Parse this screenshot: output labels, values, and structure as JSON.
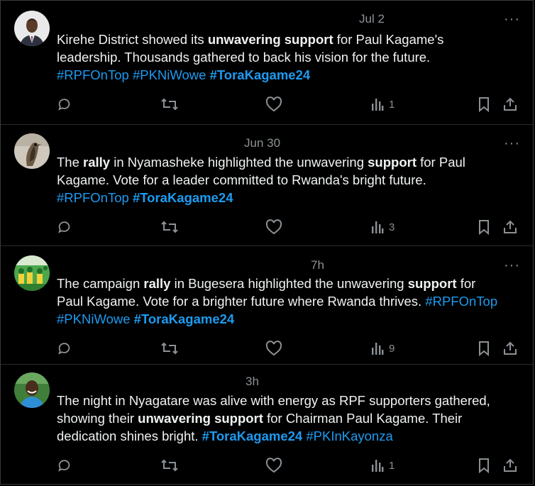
{
  "tweets": [
    {
      "time": "Jul 2",
      "lines": [
        [
          {
            "t": "Kirehe District showed its "
          },
          {
            "t": "unwavering support",
            "b": true
          },
          {
            "t": " for Paul Kagame's"
          }
        ],
        [
          {
            "t": "leadership. Thousands gathered to back his vision for the future."
          }
        ],
        [
          {
            "t": "#RPFOnTop",
            "h": true
          },
          {
            "t": " "
          },
          {
            "t": "#PKNiWowe",
            "h": true
          },
          {
            "t": " "
          },
          {
            "t": "#ToraKagame24",
            "h": true,
            "b": true
          }
        ]
      ],
      "views": "1"
    },
    {
      "time": "Jun 30",
      "lines": [
        [
          {
            "t": "The "
          },
          {
            "t": "rally",
            "b": true
          },
          {
            "t": " in Nyamasheke highlighted the unwavering "
          },
          {
            "t": "support",
            "b": true
          },
          {
            "t": " for Paul"
          }
        ],
        [
          {
            "t": "Kagame. Vote for a leader committed to Rwanda's bright future."
          }
        ],
        [
          {
            "t": "#RPFOnTop",
            "h": true
          },
          {
            "t": "  "
          },
          {
            "t": "#ToraKagame24",
            "h": true,
            "b": true
          }
        ]
      ],
      "views": "3"
    },
    {
      "time": "7h",
      "lines": [
        [
          {
            "t": "The campaign "
          },
          {
            "t": "rally",
            "b": true
          },
          {
            "t": " in Bugesera highlighted the unwavering "
          },
          {
            "t": "support",
            "b": true
          },
          {
            "t": " for"
          }
        ],
        [
          {
            "t": "Paul Kagame. Vote for a brighter future where Rwanda thrives. "
          },
          {
            "t": "#RPFOnTop",
            "h": true
          }
        ],
        [
          {
            "t": "#PKNiWowe",
            "h": true
          },
          {
            "t": " "
          },
          {
            "t": "#ToraKagame24",
            "h": true,
            "b": true
          }
        ]
      ],
      "views": "9"
    },
    {
      "time": "3h",
      "lines": [
        [
          {
            "t": "The night in Nyagatare was alive with energy as RPF supporters gathered,"
          }
        ],
        [
          {
            "t": "showing their "
          },
          {
            "t": "unwavering support",
            "b": true
          },
          {
            "t": " for Chairman Paul Kagame. Their"
          }
        ],
        [
          {
            "t": "dedication shines bright. "
          },
          {
            "t": "#ToraKagame24",
            "h": true,
            "b": true
          },
          {
            "t": " "
          },
          {
            "t": "#PKInKayonza",
            "h": true
          }
        ]
      ],
      "views": "1"
    }
  ],
  "more_label": "···",
  "colors": {
    "hashtag": "#1d9bf0",
    "muted": "#8b9196",
    "text": "#f0f2f3"
  },
  "icons": [
    "reply-icon",
    "retweet-icon",
    "like-icon",
    "views-icon",
    "bookmark-icon",
    "share-icon",
    "more-icon"
  ]
}
